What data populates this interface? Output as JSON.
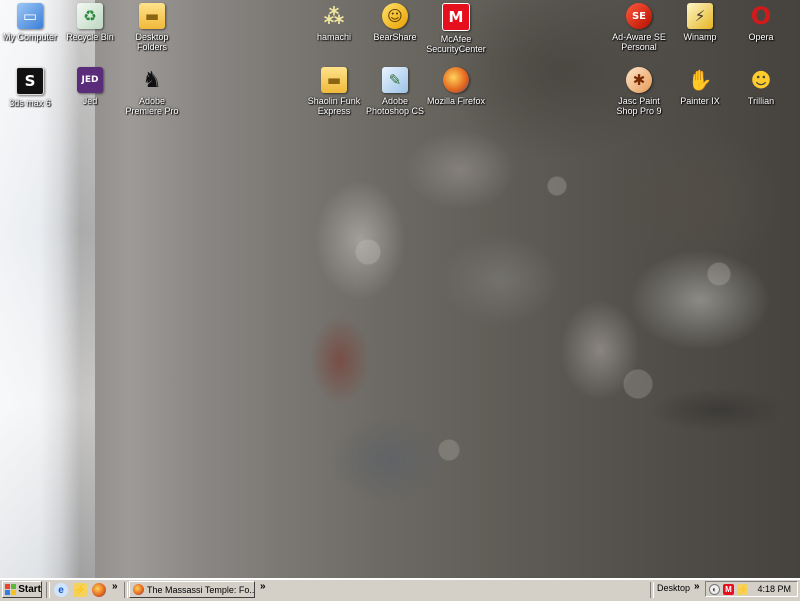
{
  "desktop": {
    "icons": [
      {
        "label": "My Computer",
        "glyph": "▭",
        "icon": "my-computer-icon"
      },
      {
        "label": "Recycle Bin",
        "glyph": "♻",
        "icon": "recycle-bin-icon"
      },
      {
        "label": "Desktop\nFolders",
        "glyph": "▬",
        "icon": "folder-icon"
      },
      {
        "label": "hamachi",
        "glyph": "⁂",
        "icon": "hamachi-icon"
      },
      {
        "label": "BearShare",
        "glyph": "☺",
        "icon": "bearshare-icon"
      },
      {
        "label": "McAfee\nSecurityCenter",
        "glyph": "M",
        "icon": "mcafee-icon"
      },
      {
        "label": "Ad-Aware SE\nPersonal",
        "glyph": "SE",
        "icon": "adaware-icon"
      },
      {
        "label": "Winamp",
        "glyph": "⚡",
        "icon": "winamp-icon"
      },
      {
        "label": "Opera",
        "glyph": "O",
        "icon": "opera-icon"
      },
      {
        "label": "3ds max 6",
        "glyph": "S",
        "icon": "3ds-max-icon"
      },
      {
        "label": "Jed",
        "glyph": "JED",
        "icon": "jed-icon"
      },
      {
        "label": "Adobe\nPremiere Pro",
        "glyph": "♞",
        "icon": "premiere-icon"
      },
      {
        "label": "Shaolin Funk\nExpress",
        "glyph": "▬",
        "icon": "folder-icon"
      },
      {
        "label": "Adobe\nPhotoshop CS",
        "glyph": "✎",
        "icon": "photoshop-icon"
      },
      {
        "label": "Mozilla Firefox",
        "glyph": "",
        "icon": "firefox-icon"
      },
      {
        "label": "Jasc Paint\nShop Pro 9",
        "glyph": "✱",
        "icon": "paint-shop-pro-icon"
      },
      {
        "label": "Painter IX",
        "glyph": "✋",
        "icon": "painter-icon"
      },
      {
        "label": "Trillian",
        "glyph": "☻",
        "icon": "trillian-icon"
      }
    ]
  },
  "taskbar": {
    "start_label": "Start",
    "quick_launch_more": "»",
    "window_more": "»",
    "task_title": "The Massassi Temple: Fo...",
    "desktop_toolbar_label": "Desktop",
    "tray_more": "»",
    "clock": "4:18 PM"
  }
}
